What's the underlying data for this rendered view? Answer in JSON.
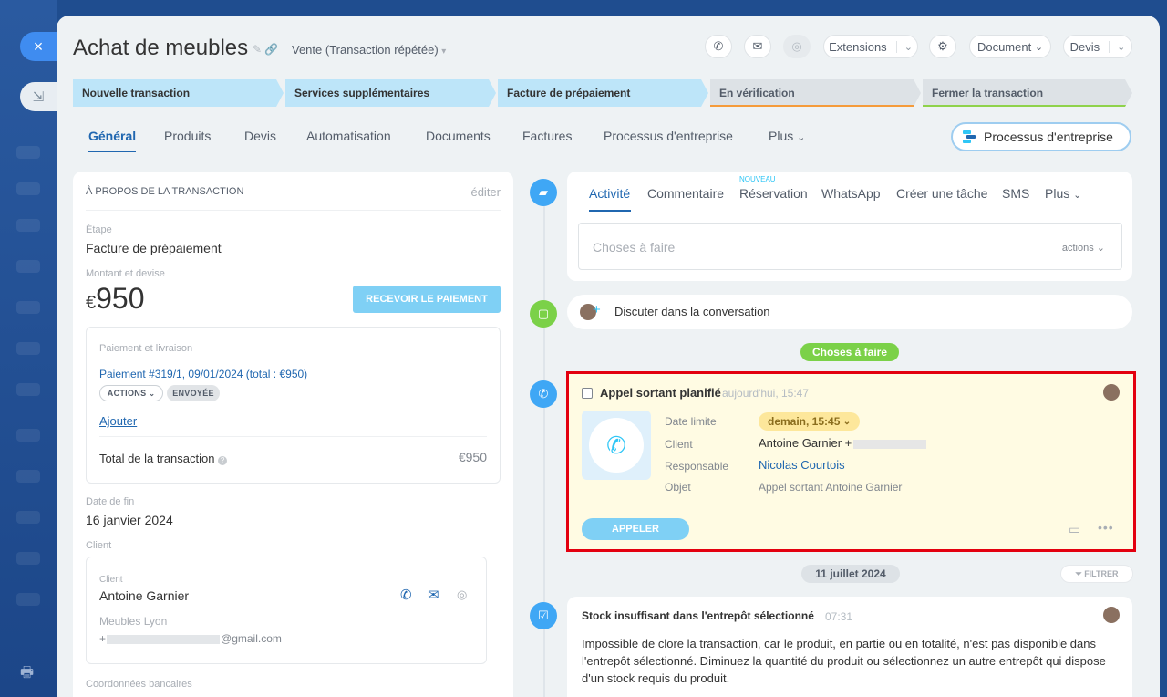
{
  "sidebar": {
    "close_icon": "×",
    "collapse_icon": "⇲",
    "print_icon": "🖶"
  },
  "header": {
    "title": "Achat de meubles",
    "subtitle": "Vente (Transaction répétée)",
    "buttons": {
      "extensions": "Extensions",
      "document": "Document",
      "devis": "Devis"
    }
  },
  "stages": [
    {
      "label": "Nouvelle transaction",
      "state": "active"
    },
    {
      "label": "Services supplémentaires",
      "state": "active"
    },
    {
      "label": "Facture de prépaiement",
      "state": "active"
    },
    {
      "label": "En vérification",
      "state": "inactive",
      "color": "#f59b3a"
    },
    {
      "label": "Fermer la transaction",
      "state": "inactive",
      "color": "#8fd24b"
    }
  ],
  "tabs": [
    "Général",
    "Produits",
    "Devis",
    "Automatisation",
    "Documents",
    "Factures",
    "Processus d'entreprise",
    "Plus"
  ],
  "business_process_button": "Processus d'entreprise",
  "about": {
    "header": "À PROPOS DE LA TRANSACTION",
    "edit": "éditer",
    "stage_label": "Étape",
    "stage_value": "Facture de prépaiement",
    "amount_label": "Montant et devise",
    "currency": "€",
    "amount": "950",
    "receive_payment": "RECEVOIR LE PAIEMENT",
    "payment_section_label": "Paiement et livraison",
    "payment_link": "Paiement #319/1, 09/01/2024 (total : €950)",
    "actions_pill": "ACTIONS",
    "sent_pill": "ENVOYÉE",
    "add_link": "Ajouter",
    "total_label": "Total de la transaction",
    "total_value": "€950",
    "end_date_label": "Date de fin",
    "end_date_value": "16 janvier 2024",
    "client_section_label": "Client",
    "client_label": "Client",
    "client_name": "Antoine Garnier",
    "client_company": "Meubles Lyon",
    "client_email": "@gmail.com",
    "bank_label": "Coordonnées bancaires"
  },
  "activity": {
    "tabs": [
      "Activité",
      "Commentaire",
      "Réservation",
      "WhatsApp",
      "Créer une tâche",
      "SMS",
      "Plus"
    ],
    "new_badge": "NOUVEAU",
    "todo_placeholder": "Choses à faire",
    "actions_label": "actions",
    "discuss": "Discuter dans la conversation",
    "todo_divider": "Choses à faire"
  },
  "call": {
    "title": "Appel sortant planifié",
    "time": "aujourd'hui, 15:47",
    "deadline_label": "Date limite",
    "deadline_value": "demain, 15:45",
    "client_label": "Client",
    "client_value": "Antoine Garnier +",
    "responsible_label": "Responsable",
    "responsible_value": "Nicolas Courtois",
    "subject_label": "Objet",
    "subject_value": "Appel sortant Antoine Garnier",
    "call_button": "APPELER"
  },
  "date_divider": "11 juillet 2024",
  "filter_label": "FILTRER",
  "stock": {
    "title": "Stock insuffisant dans l'entrepôt sélectionné",
    "time": "07:31",
    "body": "Impossible de clore la transaction, car le produit, en partie ou en totalité, n'est pas disponible dans l'entrepôt sélectionné. Diminuez la quantité du produit ou sélectionnez un autre entrepôt qui dispose d'un stock requis du produit."
  },
  "colors": {
    "accent": "#2067b0",
    "highlight": "#e3000f",
    "call_bg": "#fffbe3",
    "green": "#7bd148"
  }
}
